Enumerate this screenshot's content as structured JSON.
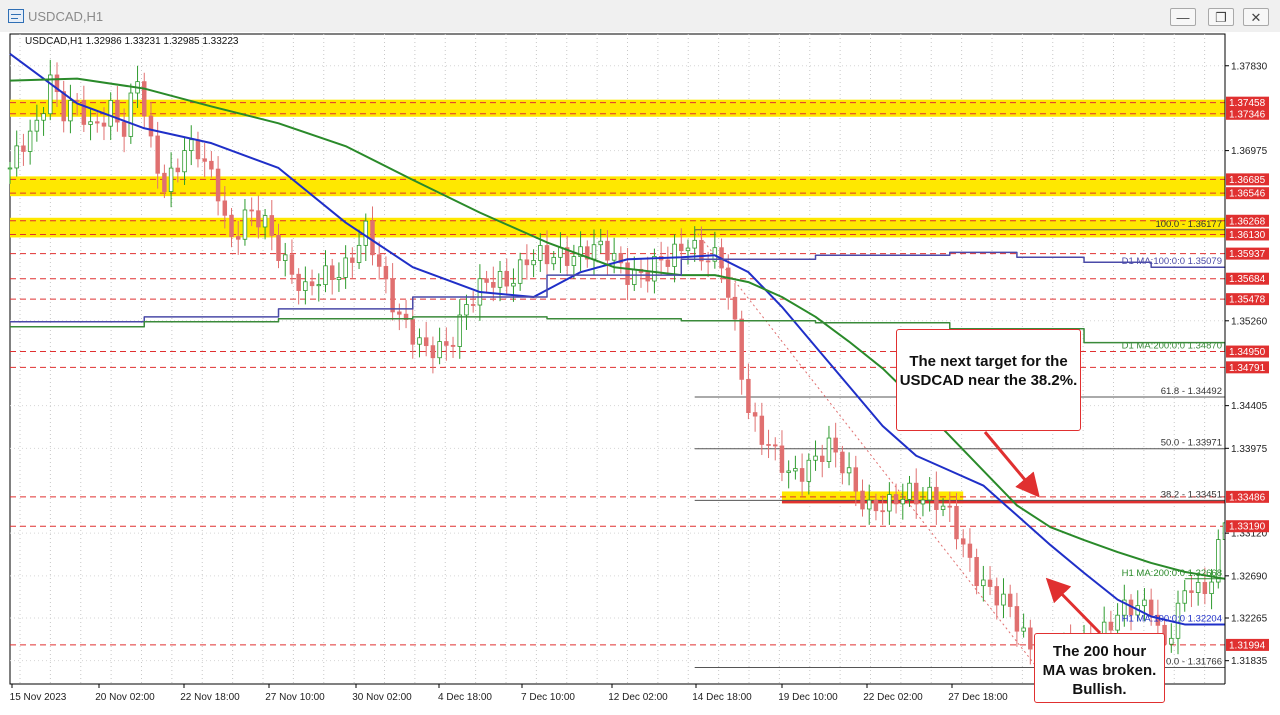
{
  "window": {
    "title": "USDCAD,H1",
    "minimize_glyph": "—",
    "restore_glyph": "❐",
    "close_glyph": "✕"
  },
  "colors": {
    "candle_up": "#2e9b2e",
    "candle_down": "#e07070",
    "ma100": "#1f2fc8",
    "ma200": "#2a8a2a",
    "d1_ma100": "#4a4aa8",
    "d1_ma200": "#3a8a3a",
    "support_resistance": "#e03030",
    "zone": "#ffe800",
    "fib": "#555555"
  },
  "chart_data": {
    "type": "candlestick",
    "title": "USDCAD,H1",
    "ohlc_label": "USDCAD,H1  1.32986 1.33231 1.32985 1.33223",
    "timeframe": "H1",
    "ylim": [
      1.316,
      1.3815
    ],
    "price_ticks": [
      "1.37830",
      "1.36975",
      "1.35260",
      "1.34405",
      "1.33975",
      "1.33120",
      "1.32690",
      "1.32265",
      "1.31835"
    ],
    "x_labels": [
      "15 Nov 2023",
      "20 Nov 02:00",
      "22 Nov 18:00",
      "27 Nov 10:00",
      "30 Nov 02:00",
      "4 Dec 18:00",
      "7 Dec 10:00",
      "12 Dec 02:00",
      "14 Dec 18:00",
      "19 Dec 10:00",
      "22 Dec 02:00",
      "27 Dec 18:00"
    ],
    "current_price": 1.33223,
    "price_path": [
      [
        0,
        1.368
      ],
      [
        4,
        1.372
      ],
      [
        6,
        1.3775
      ],
      [
        8,
        1.374
      ],
      [
        10,
        1.374
      ],
      [
        12,
        1.3715
      ],
      [
        15,
        1.3745
      ],
      [
        17,
        1.372
      ],
      [
        19,
        1.3765
      ],
      [
        21,
        1.37
      ],
      [
        23,
        1.3665
      ],
      [
        26,
        1.3698
      ],
      [
        28,
        1.3692
      ],
      [
        31,
        1.366
      ],
      [
        33,
        1.361
      ],
      [
        35,
        1.363
      ],
      [
        38,
        1.3622
      ],
      [
        41,
        1.359
      ],
      [
        44,
        1.3552
      ],
      [
        47,
        1.357
      ],
      [
        50,
        1.3585
      ],
      [
        53,
        1.3612
      ],
      [
        56,
        1.356
      ],
      [
        59,
        1.3525
      ],
      [
        62,
        1.349
      ],
      [
        65,
        1.35
      ],
      [
        68,
        1.3545
      ],
      [
        71,
        1.356
      ],
      [
        74,
        1.3568
      ],
      [
        77,
        1.359
      ],
      [
        80,
        1.3585
      ],
      [
        83,
        1.3595
      ],
      [
        86,
        1.3598
      ],
      [
        89,
        1.3592
      ],
      [
        92,
        1.3578
      ],
      [
        95,
        1.3574
      ],
      [
        98,
        1.3585
      ],
      [
        101,
        1.3612
      ],
      [
        103,
        1.3592
      ],
      [
        106,
        1.358
      ],
      [
        108,
        1.352
      ],
      [
        110,
        1.344
      ],
      [
        113,
        1.3395
      ],
      [
        116,
        1.337
      ],
      [
        119,
        1.3385
      ],
      [
        122,
        1.3395
      ],
      [
        125,
        1.337
      ],
      [
        128,
        1.334
      ],
      [
        131,
        1.3335
      ],
      [
        134,
        1.3355
      ],
      [
        137,
        1.3352
      ],
      [
        140,
        1.3325
      ],
      [
        143,
        1.3285
      ],
      [
        146,
        1.3255
      ],
      [
        149,
        1.323
      ],
      [
        152,
        1.32
      ],
      [
        155,
        1.3185
      ],
      [
        158,
        1.319
      ],
      [
        161,
        1.3205
      ],
      [
        164,
        1.322
      ],
      [
        167,
        1.3235
      ],
      [
        170,
        1.3245
      ],
      [
        172,
        1.3195
      ],
      [
        174,
        1.323
      ],
      [
        176,
        1.326
      ],
      [
        178,
        1.3255
      ],
      [
        180,
        1.33
      ],
      [
        181,
        1.3322
      ]
    ],
    "series": [
      {
        "name": "H1 MA:100:0:0",
        "last_value": "1.32204",
        "points": [
          [
            0,
            1.3795
          ],
          [
            10,
            1.3745
          ],
          [
            20,
            1.372
          ],
          [
            30,
            1.3705
          ],
          [
            40,
            1.368
          ],
          [
            50,
            1.3625
          ],
          [
            60,
            1.358
          ],
          [
            70,
            1.3555
          ],
          [
            78,
            1.355
          ],
          [
            85,
            1.3575
          ],
          [
            92,
            1.3588
          ],
          [
            100,
            1.359
          ],
          [
            105,
            1.3592
          ],
          [
            110,
            1.3575
          ],
          [
            115,
            1.354
          ],
          [
            120,
            1.35
          ],
          [
            125,
            1.346
          ],
          [
            130,
            1.342
          ],
          [
            135,
            1.339
          ],
          [
            140,
            1.3375
          ],
          [
            145,
            1.336
          ],
          [
            150,
            1.333
          ],
          [
            155,
            1.33
          ],
          [
            160,
            1.3272
          ],
          [
            165,
            1.3245
          ],
          [
            170,
            1.3228
          ],
          [
            175,
            1.322
          ],
          [
            181,
            1.322
          ]
        ]
      },
      {
        "name": "H1 MA:200:0:0",
        "last_value": "1.32668",
        "points": [
          [
            0,
            1.3768
          ],
          [
            10,
            1.377
          ],
          [
            20,
            1.376
          ],
          [
            30,
            1.3742
          ],
          [
            40,
            1.3725
          ],
          [
            50,
            1.3702
          ],
          [
            60,
            1.3668
          ],
          [
            70,
            1.3635
          ],
          [
            80,
            1.3605
          ],
          [
            90,
            1.358
          ],
          [
            100,
            1.3572
          ],
          [
            105,
            1.3572
          ],
          [
            110,
            1.3565
          ],
          [
            115,
            1.355
          ],
          [
            120,
            1.353
          ],
          [
            125,
            1.3505
          ],
          [
            130,
            1.3478
          ],
          [
            135,
            1.3445
          ],
          [
            140,
            1.341
          ],
          [
            145,
            1.3375
          ],
          [
            150,
            1.334
          ],
          [
            155,
            1.3318
          ],
          [
            160,
            1.3305
          ],
          [
            165,
            1.3293
          ],
          [
            170,
            1.3282
          ],
          [
            175,
            1.3273
          ],
          [
            181,
            1.3266
          ]
        ]
      },
      {
        "name": "D1 MA:100:0:0",
        "last_value": "1.35079",
        "points": [
          [
            0,
            1.3525
          ],
          [
            20,
            1.353
          ],
          [
            40,
            1.3538
          ],
          [
            60,
            1.355
          ],
          [
            80,
            1.3572
          ],
          [
            100,
            1.3588
          ],
          [
            120,
            1.3592
          ],
          [
            140,
            1.3595
          ],
          [
            150,
            1.359
          ],
          [
            160,
            1.3585
          ],
          [
            170,
            1.358
          ],
          [
            181,
            1.358
          ]
        ]
      },
      {
        "name": "D1 MA:200:0:0",
        "last_value": "1.34870",
        "points": [
          [
            0,
            1.352
          ],
          [
            20,
            1.3525
          ],
          [
            40,
            1.3528
          ],
          [
            60,
            1.353
          ],
          [
            80,
            1.3528
          ],
          [
            100,
            1.3526
          ],
          [
            120,
            1.3524
          ],
          [
            140,
            1.3518
          ],
          [
            160,
            1.3504
          ],
          [
            181,
            1.3495
          ]
        ]
      }
    ],
    "price_levels": [
      "1.37458",
      "1.37346",
      "1.36685",
      "1.36546",
      "1.36268",
      "1.36130",
      "1.35937",
      "1.35684",
      "1.35478",
      "1.34950",
      "1.34791",
      "1.33486",
      "1.33190",
      "1.31994"
    ],
    "zones": [
      {
        "low": 1.37346,
        "high": 1.37458
      },
      {
        "low": 1.36546,
        "high": 1.36685
      },
      {
        "low": 1.3613,
        "high": 1.36268
      },
      {
        "low": 1.3345,
        "high": 1.3351
      }
    ],
    "fibonacci": [
      {
        "label": "100.0 - 1.36177",
        "value": 1.36177
      },
      {
        "label": "61.8 - 1.34492",
        "value": 1.34492
      },
      {
        "label": "50.0 - 1.33971",
        "value": 1.33971
      },
      {
        "label": "38.2 - 1.33451",
        "value": 1.33451
      },
      {
        "label": "0.0 - 1.31766",
        "value": 1.31766
      }
    ],
    "annotations": [
      "The next target for the USDCAD near the 38.2%.",
      "The 200 hour MA was broken. Bullish."
    ]
  }
}
